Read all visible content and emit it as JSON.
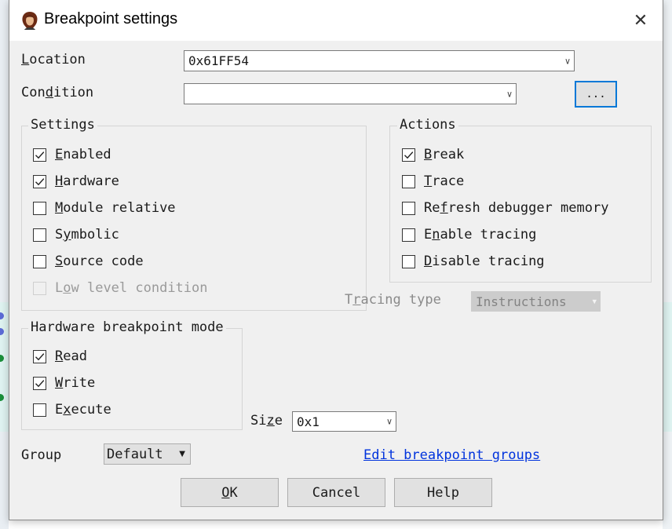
{
  "dialog": {
    "title": "Breakpoint settings",
    "close_symbol": "✕"
  },
  "location": {
    "label": "Location",
    "value": "0x61FF54"
  },
  "condition": {
    "label": "Condition",
    "value": "",
    "browse_label": "..."
  },
  "settings": {
    "title": "Settings",
    "items": [
      {
        "label": "Enabled",
        "checked": true,
        "enabled": true
      },
      {
        "label": "Hardware",
        "checked": true,
        "enabled": true
      },
      {
        "label": "Module relative",
        "checked": false,
        "enabled": true
      },
      {
        "label": "Symbolic",
        "checked": false,
        "enabled": true
      },
      {
        "label": "Source code",
        "checked": false,
        "enabled": true
      },
      {
        "label": "Low level condition",
        "checked": false,
        "enabled": false
      }
    ]
  },
  "actions": {
    "title": "Actions",
    "items": [
      {
        "label": "Break",
        "checked": true
      },
      {
        "label": "Trace",
        "checked": false
      },
      {
        "label": "Refresh debugger memory",
        "checked": false
      },
      {
        "label": "Enable tracing",
        "checked": false
      },
      {
        "label": "Disable tracing",
        "checked": false
      }
    ]
  },
  "tracing_type": {
    "label": "Tracing type",
    "value": "Instructions",
    "enabled": false
  },
  "hw_mode": {
    "title": "Hardware breakpoint mode",
    "items": [
      {
        "label": "Read",
        "checked": true
      },
      {
        "label": "Write",
        "checked": true
      },
      {
        "label": "Execute",
        "checked": false
      }
    ]
  },
  "size": {
    "label": "Size",
    "value": "0x1"
  },
  "group": {
    "label": "Group",
    "value": "Default"
  },
  "edit_groups_link": "Edit breakpoint groups",
  "buttons": {
    "ok": "OK",
    "cancel": "Cancel",
    "help": "Help"
  },
  "colors": {
    "dialog_bg": "#f0f0f0",
    "accent": "#0078d7",
    "link": "#0033dd"
  },
  "icons": {
    "app": "app-logo-icon",
    "close": "close-icon",
    "dropdown": "chevron-down-icon",
    "check": "checkmark-icon"
  }
}
